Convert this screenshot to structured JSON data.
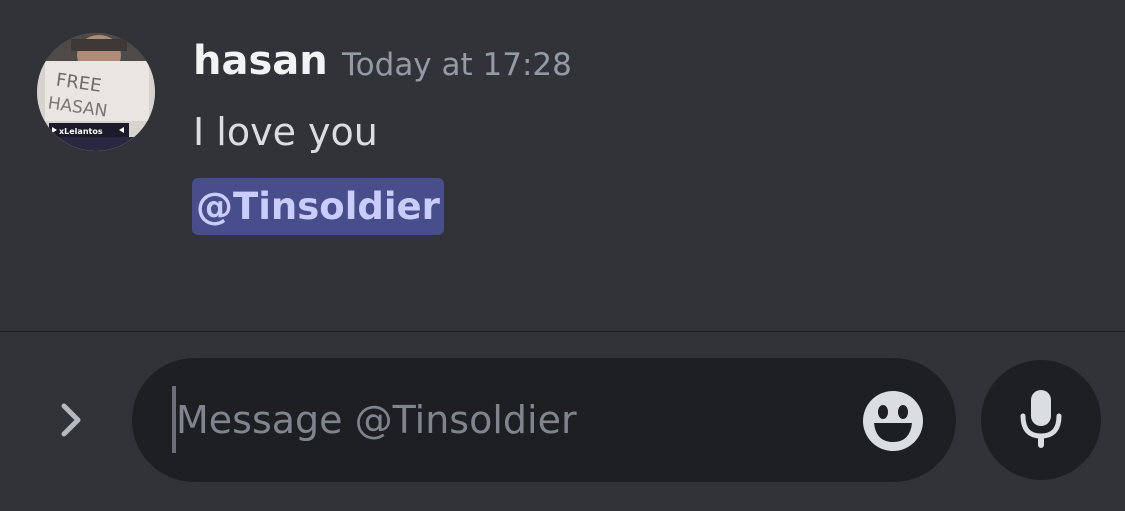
{
  "message": {
    "avatar": {
      "sign_text": "FREE HASAN",
      "overlay_label": "xLelantos"
    },
    "username": "hasan",
    "timestamp": "Today at 17:28",
    "text": "I love you",
    "mention": "@Tinsoldier"
  },
  "composer": {
    "expand_icon": "chevron-right-icon",
    "placeholder": "Message @Tinsoldier",
    "value": "",
    "emoji_icon": "smiley-face-icon",
    "mic_icon": "microphone-icon"
  },
  "colors": {
    "background": "#313338",
    "input_background": "#1e1f22",
    "mention_background": "#484d8c",
    "mention_text": "#c9cdfb",
    "username": "#f2f3f5",
    "timestamp": "#949ba4"
  }
}
